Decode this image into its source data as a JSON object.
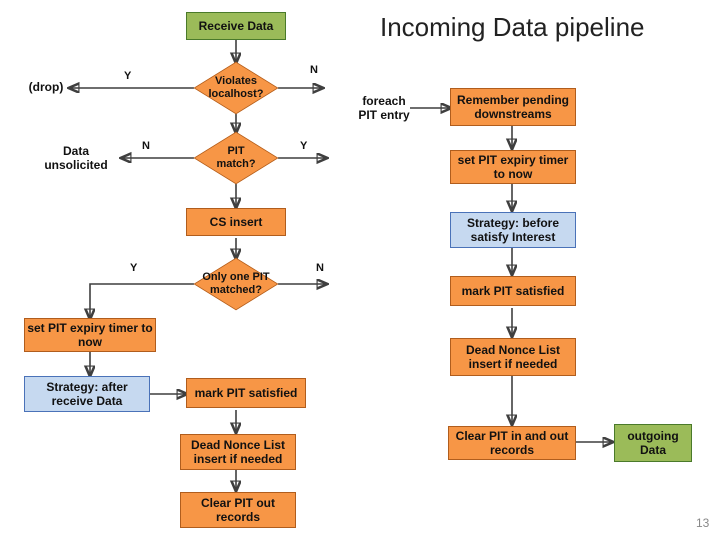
{
  "title": "Incoming Data pipeline",
  "nodes": {
    "receive_data": "Receive Data",
    "violates_localhost": "Violates\nlocalhost?",
    "drop": "(drop)",
    "pit_match": "PIT\nmatch?",
    "data_unsolicited": "Data\nunsolicited",
    "cs_insert": "CS insert",
    "only_one_pit": "Only one PIT\nmatched?",
    "set_expiry_now_left": "set PIT expiry timer\nto now",
    "strategy_after_receive": "Strategy: after\nreceive Data",
    "mark_pit_satisfied_left": "mark PIT satisfied",
    "dead_nonce_left": "Dead Nonce List\ninsert if needed",
    "clear_pit_out": "Clear PIT out\nrecords",
    "foreach_pit": "foreach\nPIT entry",
    "remember_pending": "Remember pending\ndownstreams",
    "set_expiry_now_right": "set PIT expiry timer\nto now",
    "strategy_before_satisfy": "Strategy: before\nsatisfy Interest",
    "mark_pit_satisfied_right": "mark PIT satisfied",
    "dead_nonce_right": "Dead Nonce List\ninsert if needed",
    "clear_pit_in_out": "Clear PIT in and out\nrecords",
    "outgoing_data": "outgoing\nData"
  },
  "edge_labels": {
    "violates_y": "Y",
    "violates_n": "N",
    "pitmatch_n": "N",
    "pitmatch_y": "Y",
    "onlyone_y": "Y",
    "onlyone_n": "N"
  },
  "slide_number": "13"
}
